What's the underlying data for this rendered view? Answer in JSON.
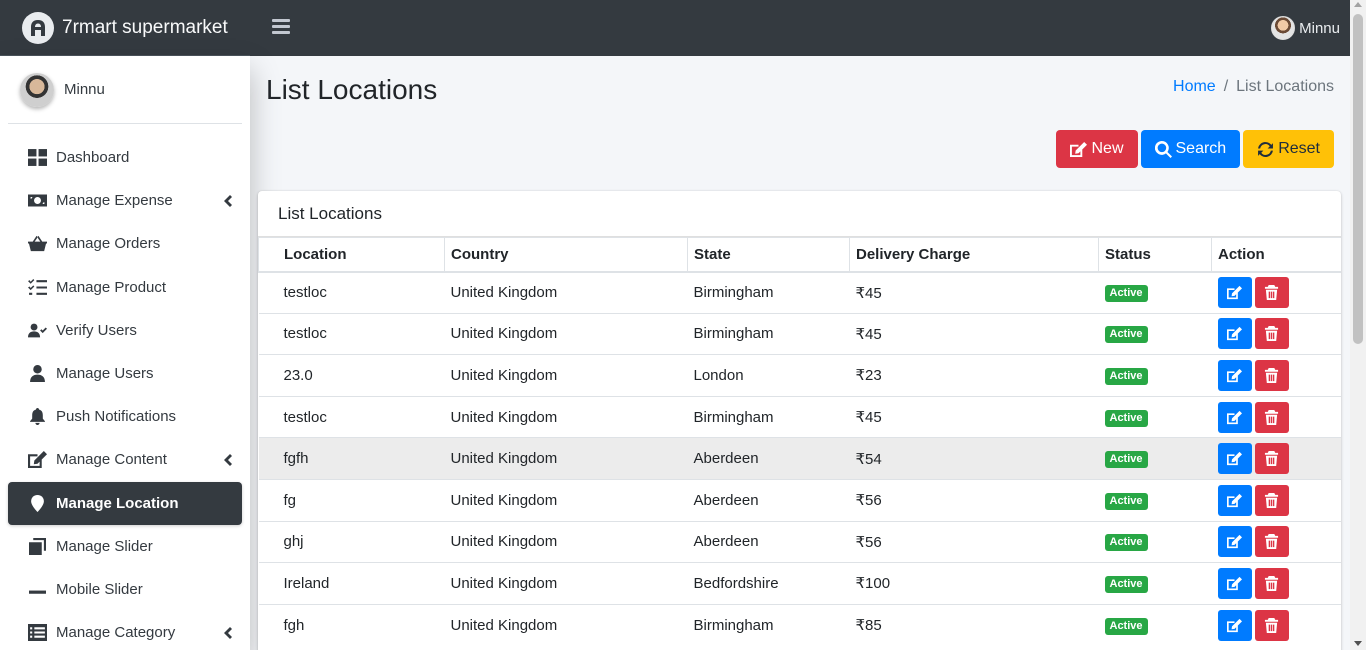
{
  "app": {
    "brand": "7rmart supermarket",
    "user": "Minnu"
  },
  "sidebar": {
    "user": "Minnu",
    "items": [
      {
        "label": "Dashboard",
        "icon": "dashboard-icon",
        "expandable": false,
        "active": false
      },
      {
        "label": "Manage Expense",
        "icon": "money-bill-icon",
        "expandable": true,
        "active": false
      },
      {
        "label": "Manage Orders",
        "icon": "basket-icon",
        "expandable": false,
        "active": false
      },
      {
        "label": "Manage Product",
        "icon": "tasks-icon",
        "expandable": false,
        "active": false
      },
      {
        "label": "Verify Users",
        "icon": "user-check-icon",
        "expandable": false,
        "active": false
      },
      {
        "label": "Manage Users",
        "icon": "user-icon",
        "expandable": false,
        "active": false
      },
      {
        "label": "Push Notifications",
        "icon": "bell-icon",
        "expandable": false,
        "active": false
      },
      {
        "label": "Manage Content",
        "icon": "edit-icon",
        "expandable": true,
        "active": false
      },
      {
        "label": "Manage Location",
        "icon": "map-marker-icon",
        "expandable": false,
        "active": true
      },
      {
        "label": "Manage Slider",
        "icon": "clone-icon",
        "expandable": false,
        "active": false
      },
      {
        "label": "Mobile Slider",
        "icon": "minus-icon",
        "expandable": false,
        "active": false
      },
      {
        "label": "Manage Category",
        "icon": "list-icon",
        "expandable": true,
        "active": false
      }
    ]
  },
  "page": {
    "title": "List Locations",
    "breadcrumb": {
      "home": "Home",
      "separator": "/",
      "current": "List Locations"
    }
  },
  "toolbar": {
    "new_label": "New",
    "search_label": "Search",
    "reset_label": "Reset"
  },
  "card": {
    "title": "List Locations"
  },
  "table": {
    "columns": [
      "Location",
      "Country",
      "State",
      "Delivery Charge",
      "Status",
      "Action"
    ],
    "rows": [
      {
        "location": "testloc",
        "country": "United Kingdom",
        "state": "Birmingham",
        "charge": "₹45",
        "status": "Active"
      },
      {
        "location": "testloc",
        "country": "United Kingdom",
        "state": "Birmingham",
        "charge": "₹45",
        "status": "Active"
      },
      {
        "location": "23.0",
        "country": "United Kingdom",
        "state": "London",
        "charge": "₹23",
        "status": "Active"
      },
      {
        "location": "testloc",
        "country": "United Kingdom",
        "state": "Birmingham",
        "charge": "₹45",
        "status": "Active"
      },
      {
        "location": "fgfh",
        "country": "United Kingdom",
        "state": "Aberdeen",
        "charge": "₹54",
        "status": "Active",
        "highlight": true
      },
      {
        "location": "fg",
        "country": "United Kingdom",
        "state": "Aberdeen",
        "charge": "₹56",
        "status": "Active"
      },
      {
        "location": "ghj",
        "country": "United Kingdom",
        "state": "Aberdeen",
        "charge": "₹56",
        "status": "Active"
      },
      {
        "location": "Ireland",
        "country": "United Kingdom",
        "state": "Bedfordshire",
        "charge": "₹100",
        "status": "Active"
      },
      {
        "location": "fgh",
        "country": "United Kingdom",
        "state": "Birmingham",
        "charge": "₹85",
        "status": "Active"
      }
    ]
  },
  "colors": {
    "navbar": "#343a40",
    "danger": "#dc3545",
    "primary": "#007bff",
    "warning": "#ffc107",
    "success": "#28a745",
    "link": "#007bff"
  }
}
